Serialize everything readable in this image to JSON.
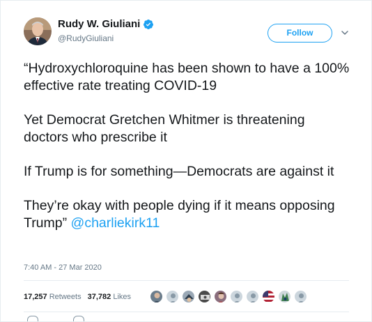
{
  "author": {
    "display_name": "Rudy W. Giuliani",
    "handle": "@RudyGiuliani",
    "verified": true,
    "avatar_icon": "profile-photo"
  },
  "header": {
    "follow_label": "Follow",
    "menu_icon": "chevron-down-icon"
  },
  "tweet": {
    "paragraphs": [
      "“Hydroxychloroquine has been shown to have a 100% effective rate treating COVID-19",
      "Yet Democrat Gretchen Whitmer is threatening doctors who prescribe it",
      "If Trump is for something—Democrats are against it",
      "They’re okay with people dying if it means opposing Trump”"
    ],
    "mention": "@charliekirk11",
    "timestamp": "7:40 AM - 27 Mar 2020"
  },
  "stats": {
    "retweets_count": "17,257",
    "retweets_label": "Retweets",
    "likes_count": "37,782",
    "likes_label": "Likes"
  },
  "colors": {
    "accent": "#1da1f2",
    "text": "#14171a",
    "muted": "#657786",
    "divider": "#e6ecf0"
  }
}
